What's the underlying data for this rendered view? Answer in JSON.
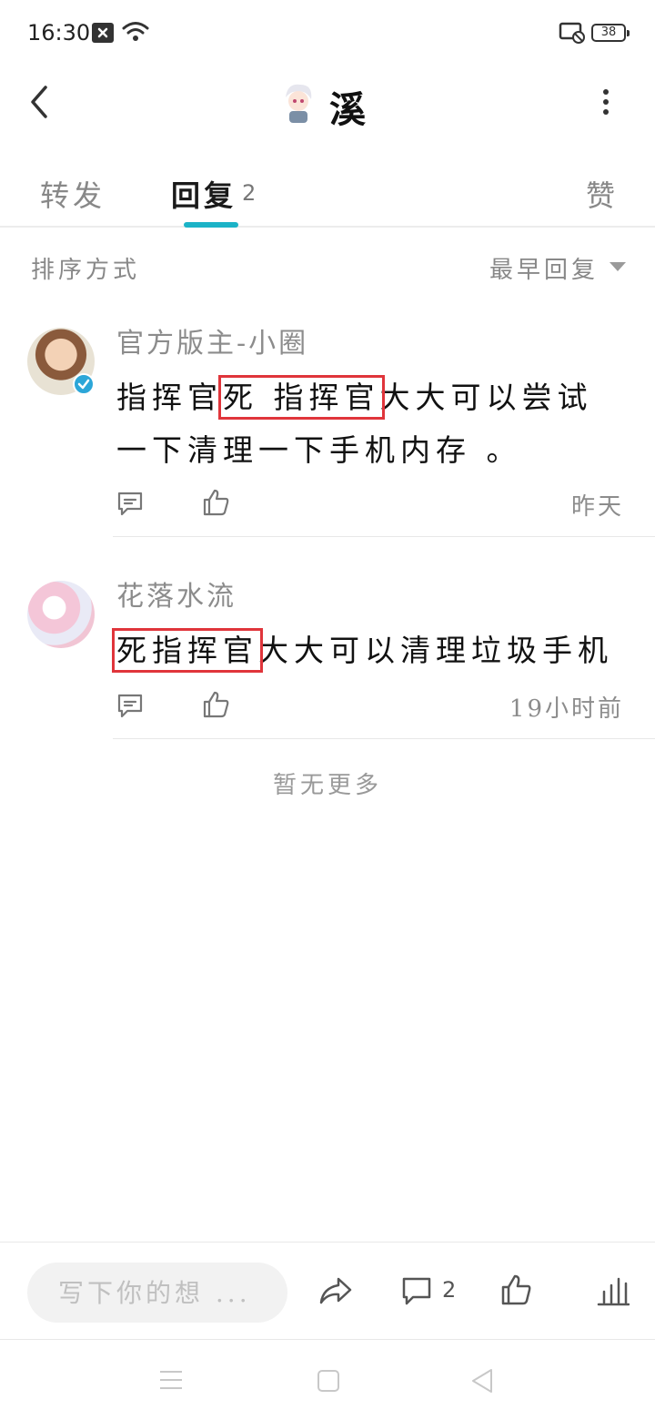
{
  "status_bar": {
    "time": "16:30",
    "battery": "38",
    "icons": [
      "notification-x-icon",
      "wifi-icon",
      "cast-off-icon",
      "battery-icon"
    ]
  },
  "header": {
    "title": "溪",
    "back_icon": "chevron-left-icon",
    "more_icon": "vertical-dots-icon"
  },
  "tabs": {
    "forward_label": "转发",
    "reply_label": "回复",
    "reply_count": "2",
    "like_label": "赞",
    "active": "reply",
    "accent_color": "#1bb3c7"
  },
  "sort": {
    "label": "排序方式",
    "value": "最早回复"
  },
  "replies": [
    {
      "name": "官方版主-小圈",
      "verified": true,
      "body_before": "指挥官",
      "body_highlight": "死 指挥官",
      "body_after": "大大可以尝试一下清理一下手机内存 。",
      "time": "昨天"
    },
    {
      "name": "花落水流",
      "verified": false,
      "body_before": "",
      "body_highlight": "死指挥官",
      "body_after": "大大可以清理垃圾手机",
      "time": "19小时前"
    }
  ],
  "no_more_text": "暂无更多",
  "bottom_bar": {
    "input_placeholder": "写下你的想 ...",
    "comment_count": "2"
  },
  "highlight_color": "#e0353b"
}
